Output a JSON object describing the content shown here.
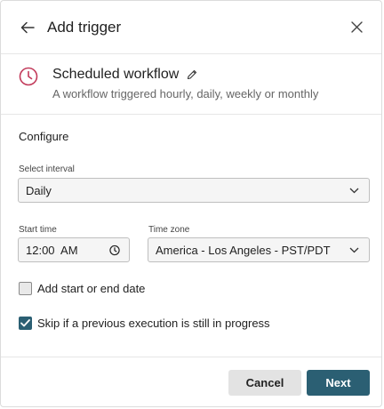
{
  "header": {
    "title": "Add trigger"
  },
  "trigger": {
    "title": "Scheduled workflow",
    "description": "A workflow triggered hourly, daily, weekly or monthly"
  },
  "configure": {
    "section_title": "Configure",
    "interval": {
      "label": "Select interval",
      "value": "Daily"
    },
    "start_time": {
      "label": "Start time",
      "value": "12:00  AM"
    },
    "time_zone": {
      "label": "Time zone",
      "value": "America - Los Angeles - PST/PDT"
    },
    "add_date": {
      "label": "Add start or end date",
      "checked": false
    },
    "skip": {
      "label": "Skip if a previous execution is still in progress",
      "checked": true
    }
  },
  "footer": {
    "cancel_label": "Cancel",
    "next_label": "Next"
  },
  "colors": {
    "accent": "#2b5f73",
    "clock_icon": "#c23a5a"
  }
}
